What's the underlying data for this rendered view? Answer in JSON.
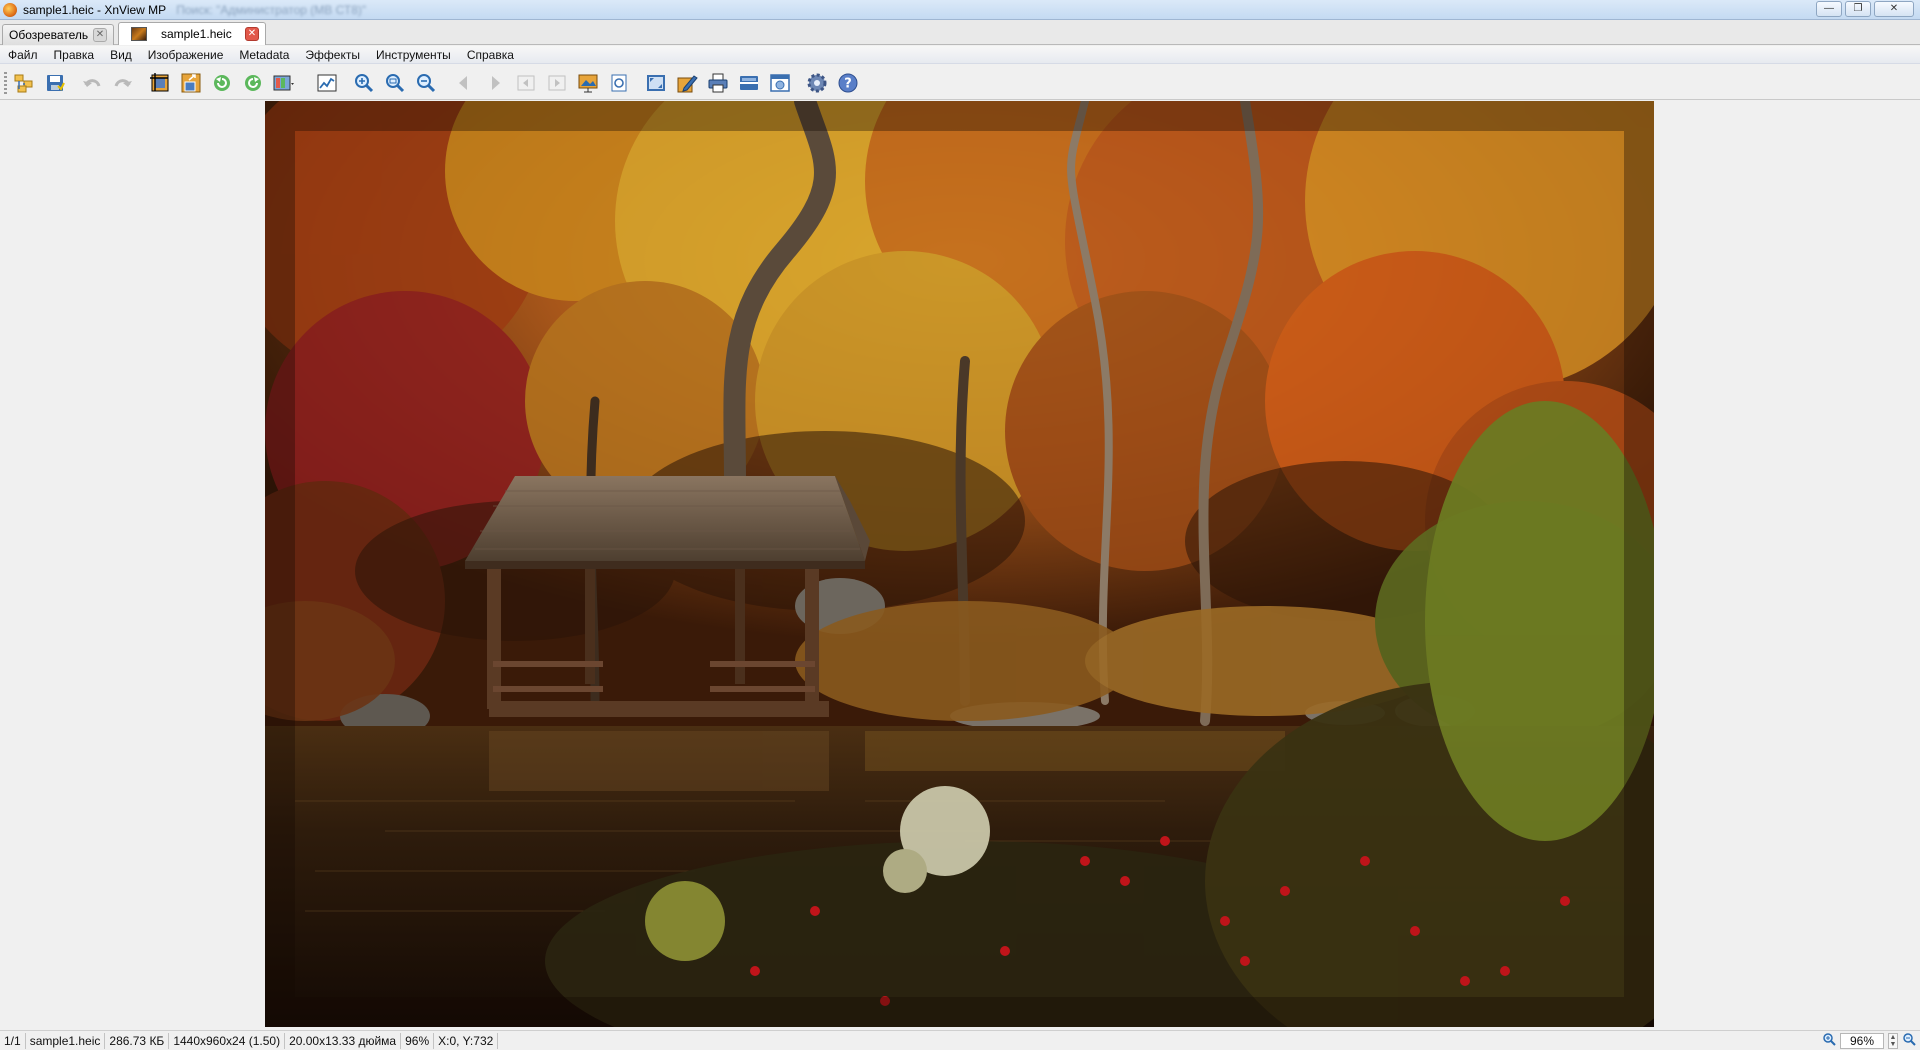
{
  "window": {
    "title": "sample1.heic - XnView MP",
    "subtitle_blurred": "Поиск: \"Администратор (МВ СТ8)\"",
    "minimize": "—",
    "maximize": "❐",
    "close": "✕"
  },
  "tabs": [
    {
      "label": "Обозреватель",
      "active": false
    },
    {
      "label": "sample1.heic",
      "active": true
    }
  ],
  "menu": [
    "Файл",
    "Правка",
    "Вид",
    "Изображение",
    "Metadata",
    "Эффекты",
    "Инструменты",
    "Справка"
  ],
  "toolbar": {
    "icons": [
      "browser-icon",
      "save-icon",
      "undo-icon",
      "redo-icon",
      "crop-icon",
      "resize-icon",
      "rotate-left-icon",
      "rotate-right-icon",
      "color-adjust-icon",
      "levels-icon",
      "zoom-in-icon",
      "zoom-fit-icon",
      "zoom-out-icon",
      "prev-icon",
      "next-icon",
      "first-icon",
      "last-icon",
      "slideshow-icon",
      "info-icon",
      "fullscreen-icon",
      "edit-icon",
      "print-icon",
      "scan-icon",
      "capture-icon",
      "settings-icon",
      "help-icon"
    ]
  },
  "status": {
    "index": "1/1",
    "filename": "sample1.heic",
    "filesize": "286.73 КБ",
    "dimensions": "1440x960x24 (1.50)",
    "print_size": "20.00x13.33 дюйма",
    "zoom_percent": "96%",
    "cursor": "X:0, Y:732",
    "zoom_value": "96%"
  },
  "colors": {
    "titlebar": "#c4daf2",
    "close_tab": "#e2584a",
    "viewer_bg": "#f0f0f0"
  }
}
